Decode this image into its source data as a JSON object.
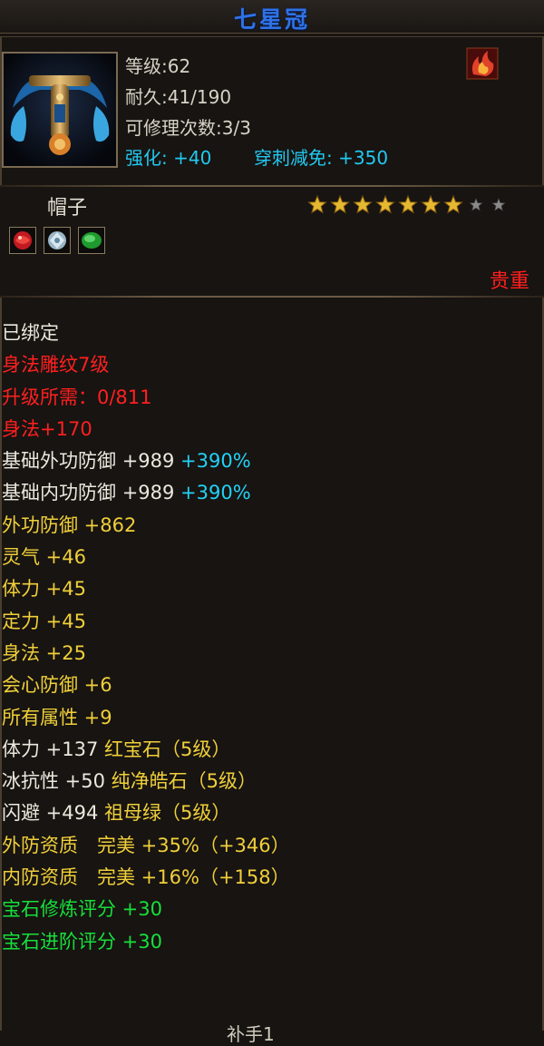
{
  "item": {
    "title": "七星冠",
    "level": "等级:62",
    "durability": "耐久:41/190",
    "repairs": "可修理次数:3/3",
    "enhance_label": "强化:",
    "enhance_value": "+40",
    "pierce_label": "穿刺减免:",
    "pierce_value": "+350",
    "slot": "帽子",
    "rarity": "贵重",
    "stars_filled": 7,
    "stars_total": 9,
    "icon": "seven-star-crown-helmet-icon",
    "badge_icon": "flame-rank-icon",
    "gem_icons": [
      "red-gem-icon",
      "white-gem-icon",
      "green-gem-icon"
    ],
    "colors": {
      "title": "#2f72e6",
      "white": "#ece8de",
      "red": "#ff2020",
      "yellow": "#f0cf3a",
      "cyan": "#22d2f6",
      "green": "#16e03a"
    }
  },
  "properties": [
    {
      "color": "white",
      "parts": [
        "已绑定"
      ]
    },
    {
      "color": "red",
      "parts": [
        "身法雕纹7级"
      ]
    },
    {
      "color": "red",
      "parts": [
        "升级所需：0/811"
      ]
    },
    {
      "color": "red",
      "parts": [
        "身法+170"
      ]
    },
    {
      "color": "white",
      "parts": [
        "基础外功防御 ",
        "+989 ",
        "+390%"
      ],
      "part_colors": [
        "white",
        "white",
        "cyan"
      ]
    },
    {
      "color": "white",
      "parts": [
        "基础内功防御 ",
        "+989 ",
        "+390%"
      ],
      "part_colors": [
        "white",
        "white",
        "cyan"
      ]
    },
    {
      "color": "yellow",
      "parts": [
        "外功防御 +862"
      ]
    },
    {
      "color": "yellow",
      "parts": [
        "灵气 +46"
      ]
    },
    {
      "color": "yellow",
      "parts": [
        "体力 +45"
      ]
    },
    {
      "color": "yellow",
      "parts": [
        "定力 +45"
      ]
    },
    {
      "color": "yellow",
      "parts": [
        "身法 +25"
      ]
    },
    {
      "color": "yellow",
      "parts": [
        "会心防御 +6"
      ]
    },
    {
      "color": "yellow",
      "parts": [
        "所有属性 +9"
      ]
    },
    {
      "color": "white",
      "parts": [
        "体力 +137 ",
        "红宝石（5级）"
      ],
      "part_colors": [
        "white",
        "yellow"
      ]
    },
    {
      "color": "white",
      "parts": [
        "冰抗性 +50 ",
        "纯净皓石（5级）"
      ],
      "part_colors": [
        "white",
        "yellow"
      ]
    },
    {
      "color": "white",
      "parts": [
        "闪避 +494 ",
        "祖母绿（5级）"
      ],
      "part_colors": [
        "white",
        "yellow"
      ]
    },
    {
      "color": "yellow",
      "parts": [
        "外防资质　完美 +35%（+346）"
      ]
    },
    {
      "color": "yellow",
      "parts": [
        "内防资质　完美 +16%（+158）"
      ]
    },
    {
      "color": "green",
      "parts": [
        "宝石修炼评分 +30"
      ]
    },
    {
      "color": "green",
      "parts": [
        "宝石进阶评分 +30"
      ]
    }
  ],
  "footer": {
    "text": "补手1"
  }
}
